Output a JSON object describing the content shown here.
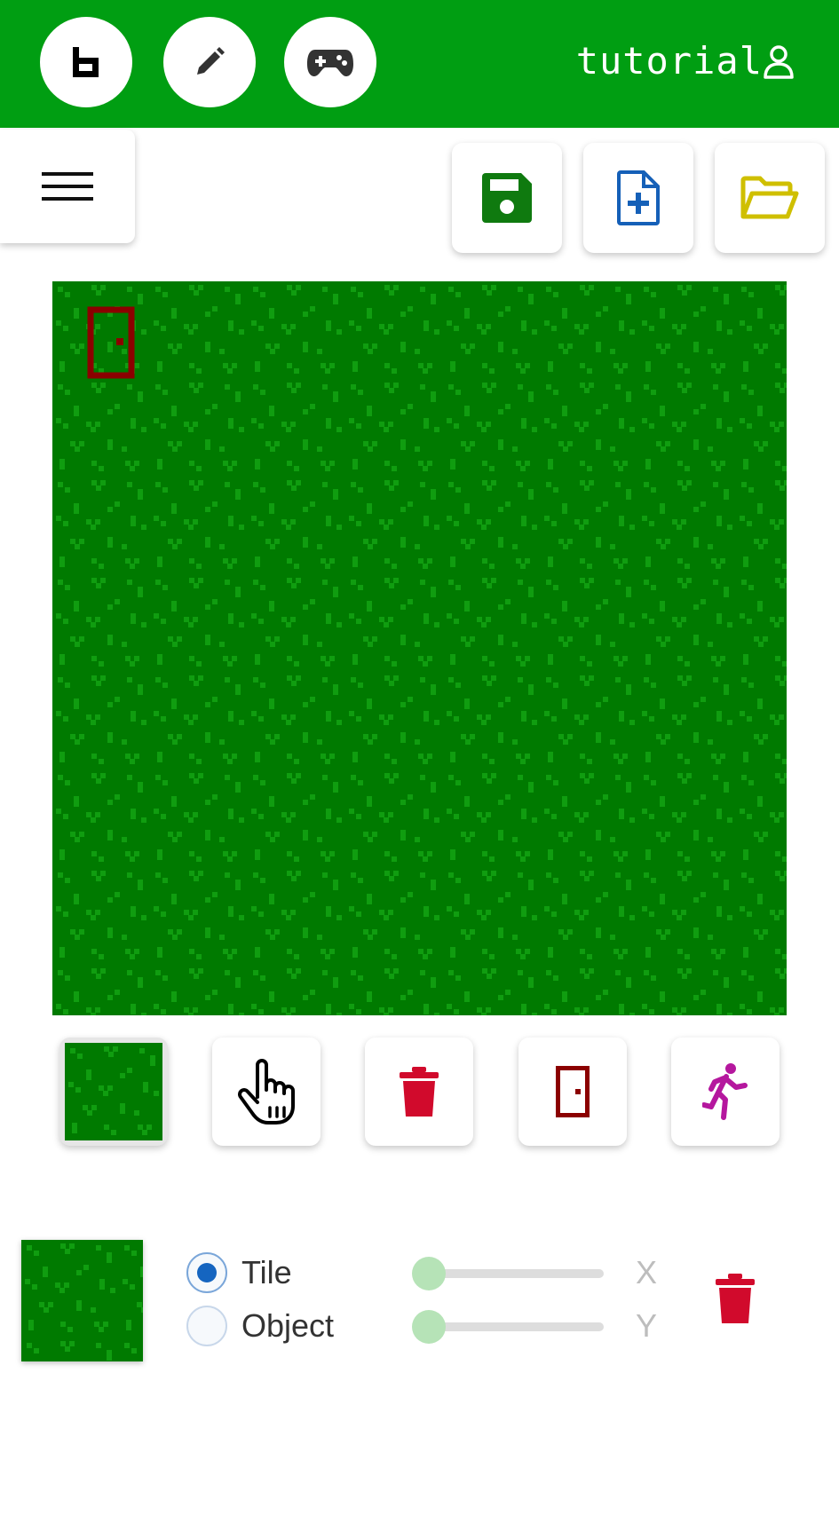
{
  "header": {
    "user_label": "tutorial",
    "buttons": [
      {
        "icon": "b-logo-icon"
      },
      {
        "icon": "pencil-icon"
      },
      {
        "icon": "gamepad-icon"
      }
    ],
    "background_color": "#009e12"
  },
  "toolbar": {
    "menu_icon": "hamburger-menu-icon",
    "save_icon": "save-icon",
    "new_file_icon": "new-file-icon",
    "open_folder_icon": "open-folder-icon"
  },
  "map": {
    "tile": "grass",
    "objects": [
      {
        "type": "door",
        "color": "#8b0000"
      }
    ]
  },
  "tools": [
    {
      "name": "grass-tile-tool",
      "selected": true
    },
    {
      "name": "pointer-tool",
      "icon": "hand-pointer-icon"
    },
    {
      "name": "delete-tool",
      "icon": "trash-icon",
      "color": "#d10a2c"
    },
    {
      "name": "door-tool",
      "icon": "door-icon",
      "color": "#8b0000"
    },
    {
      "name": "player-tool",
      "icon": "running-person-icon",
      "color": "#b5179e"
    }
  ],
  "panel": {
    "radio_tile_label": "Tile",
    "radio_object_label": "Object",
    "selected_mode": "Tile",
    "x_label": "X",
    "y_label": "Y",
    "x_value": 0,
    "y_value": 0
  }
}
